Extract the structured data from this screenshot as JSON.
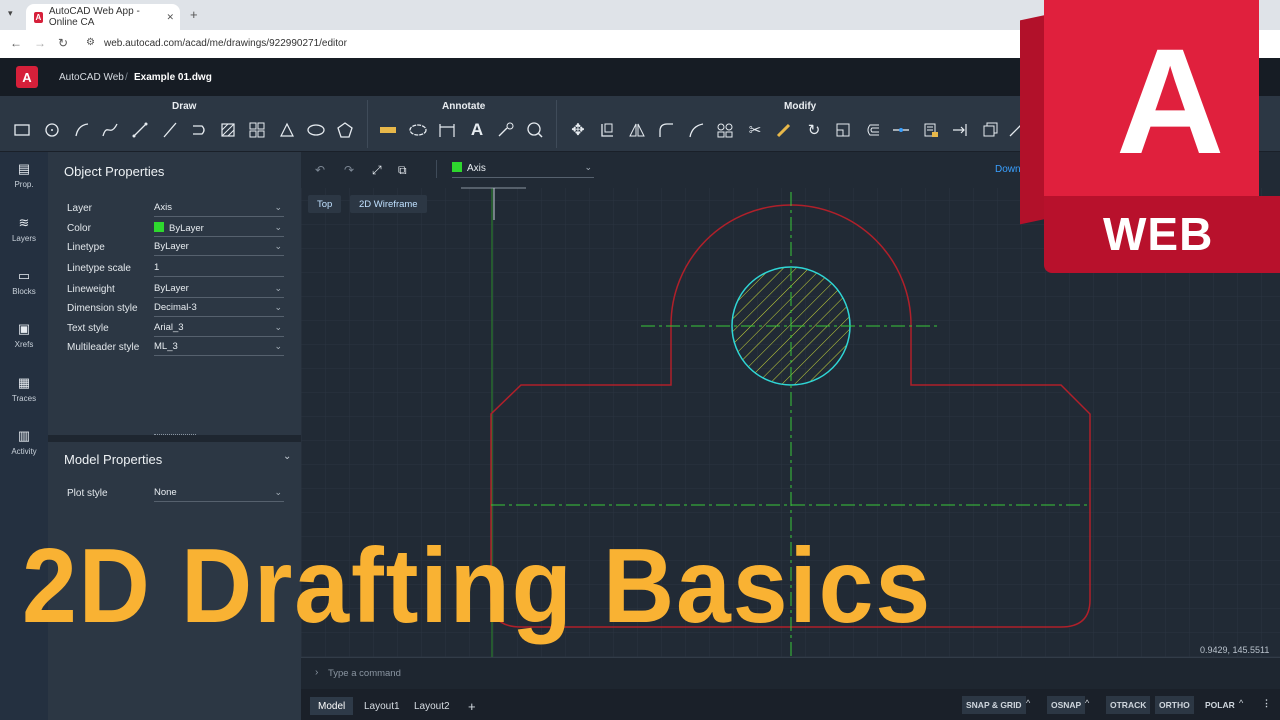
{
  "browser": {
    "tab_title": "AutoCAD Web App - Online CA",
    "tab_close": "✕",
    "new_tab": "+",
    "url": "web.autocad.com/acad/me/drawings/922990271/editor"
  },
  "app": {
    "logo_letter": "A",
    "name": "AutoCAD Web",
    "separator": "/",
    "document": "Example 01.dwg"
  },
  "ribbon": {
    "groups": [
      "Draw",
      "Annotate",
      "Modify"
    ]
  },
  "rail": {
    "items": [
      {
        "label": "Prop.",
        "icon": "properties-icon"
      },
      {
        "label": "Layers",
        "icon": "layers-icon"
      },
      {
        "label": "Blocks",
        "icon": "blocks-icon"
      },
      {
        "label": "Xrefs",
        "icon": "xrefs-icon"
      },
      {
        "label": "Traces",
        "icon": "traces-icon"
      },
      {
        "label": "Activity",
        "icon": "activity-icon"
      }
    ]
  },
  "object_properties": {
    "title": "Object Properties",
    "rows": [
      {
        "label": "Layer",
        "value": "Axis"
      },
      {
        "label": "Color",
        "value": "ByLayer"
      },
      {
        "label": "Linetype",
        "value": "ByLayer"
      },
      {
        "label": "Linetype scale",
        "value": "1"
      },
      {
        "label": "Lineweight",
        "value": "ByLayer"
      },
      {
        "label": "Dimension style",
        "value": "Decimal-3"
      },
      {
        "label": "Text style",
        "value": "Arial_3"
      },
      {
        "label": "Multileader style",
        "value": "ML_3"
      }
    ],
    "color_swatch": "#2ed82e"
  },
  "model_properties": {
    "title": "Model Properties",
    "rows": [
      {
        "label": "Plot style",
        "value": "None"
      }
    ]
  },
  "canvas": {
    "layer_selector": "Axis",
    "download_label": "Downl",
    "view_buttons": [
      "Top",
      "2D Wireframe"
    ],
    "coordinates": "0.9429, 145.5511"
  },
  "command": {
    "placeholder": "Type a command"
  },
  "layout_tabs": [
    "Model",
    "Layout1",
    "Layout2"
  ],
  "add_layout": "+",
  "status_buttons": [
    "SNAP & GRID",
    "OSNAP",
    "OTRACK",
    "ORTHO",
    "POLAR"
  ],
  "overlay_title": "2D Drafting Basics",
  "badge": {
    "letter": "A",
    "text": "WEB"
  },
  "colors": {
    "accent_red": "#d6203a",
    "title_yellow": "#f9b233",
    "outline_red": "#b0202a",
    "axis_green": "#39c839",
    "circle_cyan": "#2fd6d6",
    "hatch_yellow": "#c8d83a"
  }
}
